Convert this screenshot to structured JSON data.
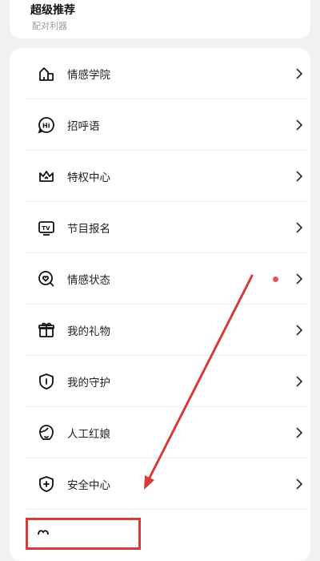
{
  "top_card": {
    "title": "超级推荐",
    "subtitle": "配对利器"
  },
  "menu": {
    "items": [
      {
        "label": "情感学院",
        "icon": "school-icon",
        "dot": false
      },
      {
        "label": "招呼语",
        "icon": "hi-chat-icon",
        "dot": false
      },
      {
        "label": "特权中心",
        "icon": "crown-icon",
        "dot": false
      },
      {
        "label": "节目报名",
        "icon": "tv-icon",
        "dot": false
      },
      {
        "label": "情感状态",
        "icon": "heart-search-icon",
        "dot": true
      },
      {
        "label": "我的礼物",
        "icon": "gift-icon",
        "dot": false
      },
      {
        "label": "我的守护",
        "icon": "shield-info-icon",
        "dot": false
      },
      {
        "label": "人工红娘",
        "icon": "matchmaker-icon",
        "dot": false
      },
      {
        "label": "安全中心",
        "icon": "shield-plus-icon",
        "dot": false
      }
    ]
  },
  "colors": {
    "accent": "#d63a3a",
    "dot": "#e8505b",
    "background": "#f1f1f4"
  }
}
